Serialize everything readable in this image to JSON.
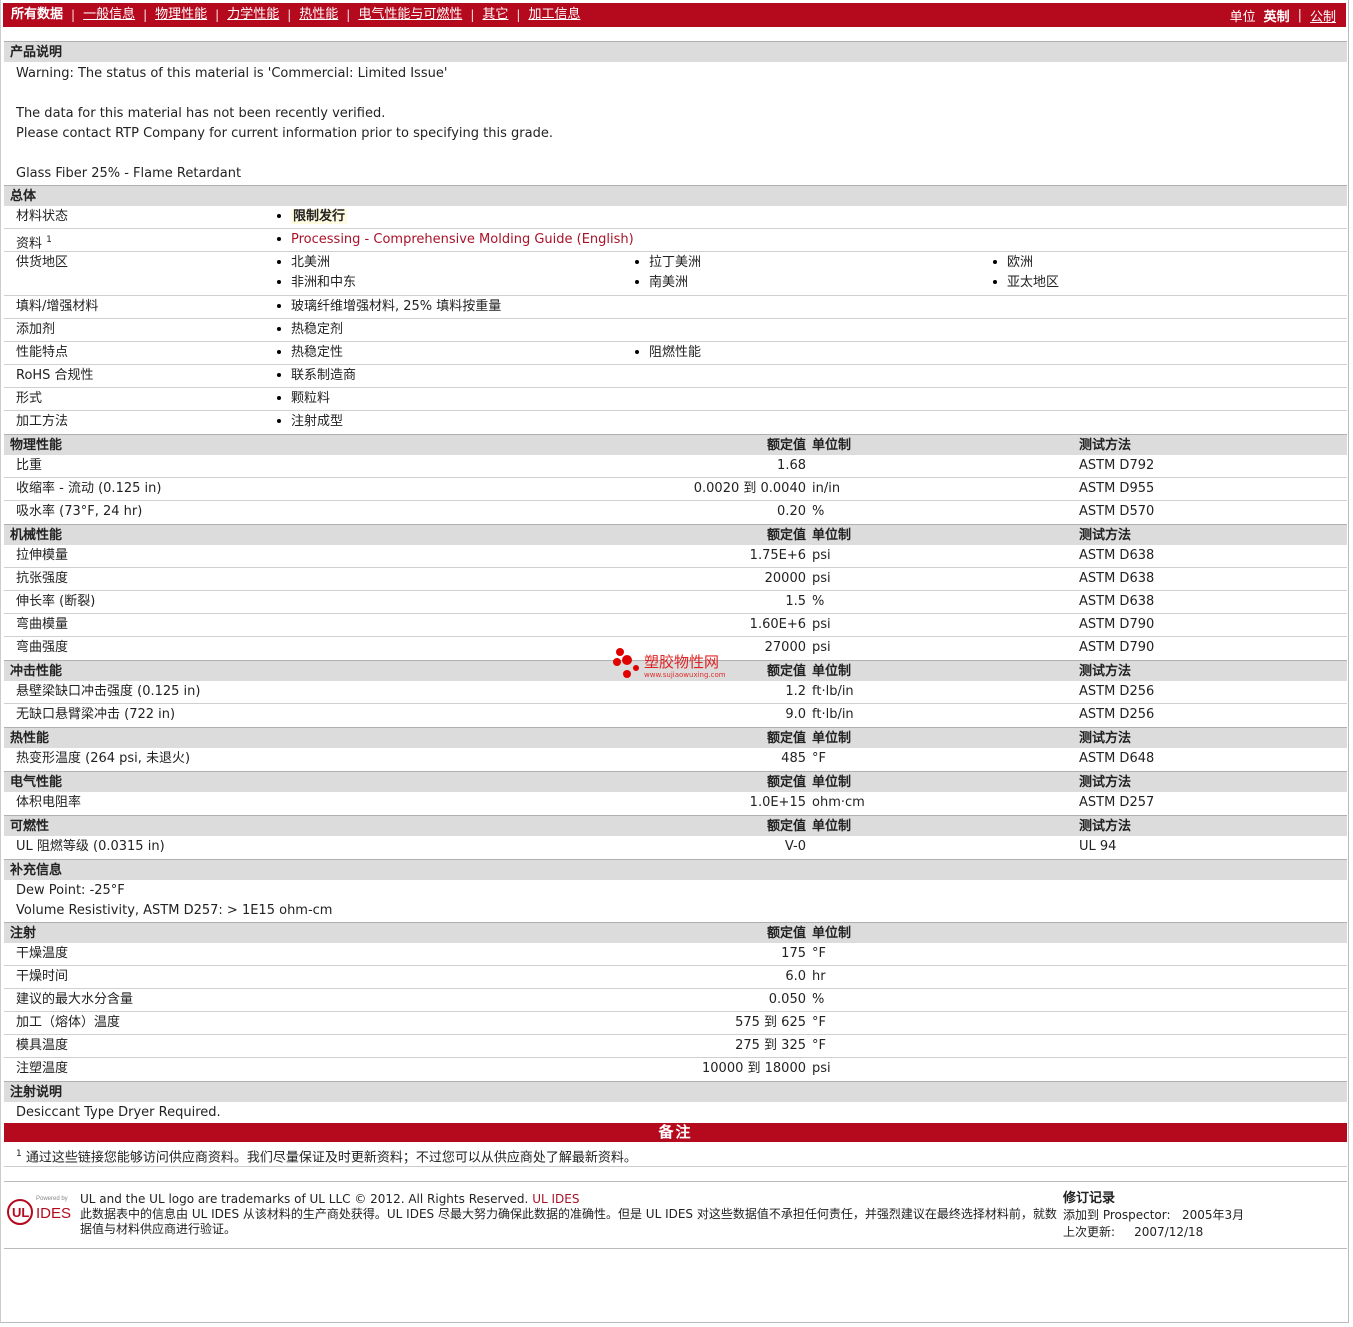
{
  "nav": {
    "tabs": [
      "所有数据",
      "一般信息",
      "物理性能",
      "力学性能",
      "热性能",
      "电气性能与可燃性",
      "其它",
      "加工信息"
    ],
    "units_label": "单位",
    "unit_english": "英制",
    "unit_metric": "公制"
  },
  "product": {
    "section": "产品说明",
    "warning": "Warning: The status of this material is 'Commercial: Limited Issue'",
    "verify1": "The data for this material has not been recently verified.",
    "verify2": "Please contact RTP Company for current information prior to specifying this grade.",
    "desc": "Glass Fiber 25% - Flame Retardant"
  },
  "general": {
    "section": "总体",
    "status_label": "材料状态",
    "status_value": "限制发行",
    "docs_label": "资料",
    "docs_sup": "1",
    "docs_link": "Processing - Comprehensive Molding Guide (English)",
    "supply_label": "供货地区",
    "supply": [
      "北美洲",
      "拉丁美洲",
      "欧洲",
      "非洲和中东",
      "南美洲",
      "亚太地区"
    ],
    "filler_label": "填料/增强材料",
    "filler_value": "玻璃纤维增强材料, 25% 填料按重量",
    "additive_label": "添加剂",
    "additive_value": "热稳定剂",
    "features_label": "性能特点",
    "features": [
      "热稳定性",
      "阻燃性能"
    ],
    "rohs_label": "RoHS 合规性",
    "rohs_value": "联系制造商",
    "form_label": "形式",
    "form_value": "颗粒料",
    "process_label": "加工方法",
    "process_value": "注射成型"
  },
  "headers": {
    "nominal": "额定值",
    "unit": "单位制",
    "method": "测试方法"
  },
  "physical": {
    "section": "物理性能",
    "rows": [
      {
        "label": "比重",
        "value": "1.68",
        "unit": "",
        "method": "ASTM D792"
      },
      {
        "label": "收缩率 - 流动 (0.125 in)",
        "value": "0.0020 到 0.0040",
        "unit": "in/in",
        "method": "ASTM D955"
      },
      {
        "label": "吸水率 (73°F, 24 hr)",
        "value": "0.20",
        "unit": "%",
        "method": "ASTM D570"
      }
    ]
  },
  "mechanical": {
    "section": "机械性能",
    "rows": [
      {
        "label": "拉伸模量",
        "value": "1.75E+6",
        "unit": "psi",
        "method": "ASTM D638"
      },
      {
        "label": "抗张强度",
        "value": "20000",
        "unit": "psi",
        "method": "ASTM D638"
      },
      {
        "label": "伸长率 (断裂)",
        "value": "1.5",
        "unit": "%",
        "method": "ASTM D638"
      },
      {
        "label": "弯曲模量",
        "value": "1.60E+6",
        "unit": "psi",
        "method": "ASTM D790"
      },
      {
        "label": "弯曲强度",
        "value": "27000",
        "unit": "psi",
        "method": "ASTM D790"
      }
    ]
  },
  "impact": {
    "section": "冲击性能",
    "rows": [
      {
        "label": "悬壁梁缺口冲击强度 (0.125 in)",
        "value": "1.2",
        "unit": "ft·lb/in",
        "method": "ASTM D256"
      },
      {
        "label": "无缺口悬臂梁冲击 (722 in)",
        "value": "9.0",
        "unit": "ft·lb/in",
        "method": "ASTM D256"
      }
    ]
  },
  "thermal": {
    "section": "热性能",
    "rows": [
      {
        "label": "热变形温度 (264 psi, 未退火)",
        "value": "485",
        "unit": "°F",
        "method": "ASTM D648"
      }
    ]
  },
  "electrical": {
    "section": "电气性能",
    "rows": [
      {
        "label": "体积电阻率",
        "value": "1.0E+15",
        "unit": "ohm·cm",
        "method": "ASTM D257"
      }
    ]
  },
  "flammability": {
    "section": "可燃性",
    "rows": [
      {
        "label": "UL 阻燃等级 (0.0315 in)",
        "value": "V-0",
        "unit": "",
        "method": "UL 94"
      }
    ]
  },
  "supplemental": {
    "section": "补充信息",
    "line1": "Dew Point: -25°F",
    "line2": "Volume Resistivity, ASTM D257: > 1E15 ohm-cm"
  },
  "injection": {
    "section": "注射",
    "rows": [
      {
        "label": "干燥温度",
        "value": "175",
        "unit": "°F"
      },
      {
        "label": "干燥时间",
        "value": "6.0",
        "unit": "hr"
      },
      {
        "label": "建议的最大水分含量",
        "value": "0.050",
        "unit": "%"
      },
      {
        "label": "加工（熔体）温度",
        "value": "575 到 625",
        "unit": "°F"
      },
      {
        "label": "模具温度",
        "value": "275 到 325",
        "unit": "°F"
      },
      {
        "label": "注塑温度",
        "value": "10000 到 18000",
        "unit": "psi"
      }
    ]
  },
  "injection_notes": {
    "section": "注射说明",
    "text": "Desiccant Type Dryer Required."
  },
  "notes": {
    "title": "备注",
    "sup": "1",
    "text": "通过这些链接您能够访问供应商资料。我们尽量保证及时更新资料；不过您可以从供应商处了解最新资料。"
  },
  "footer": {
    "logo_powered": "Powered by",
    "logo_ul": "UL",
    "logo_ides": "IDES",
    "trademark": "UL and the UL logo are trademarks of UL LLC © 2012. All Rights Reserved.",
    "trademark_link": "UL IDES",
    "disclaimer": "此数据表中的信息由 UL IDES 从该材料的生产商处获得。UL IDES 尽最大努力确保此数据的准确性。但是 UL IDES 对这些数据值不承担任何责任，并强烈建议在最终选择材料前，就数据值与材料供应商进行验证。",
    "rev_title": "修订记录",
    "added_label": "添加到 Prospector:",
    "added_value": "2005年3月",
    "updated_label": "上次更新:",
    "updated_value": "2007/12/18"
  },
  "watermark": {
    "cn": "塑胶物性网",
    "url": "www.sujiaowuxing.com"
  },
  "colors": {
    "brand": "#b5091e",
    "section_bg": "#dcdcdc",
    "link": "#a8132a"
  }
}
